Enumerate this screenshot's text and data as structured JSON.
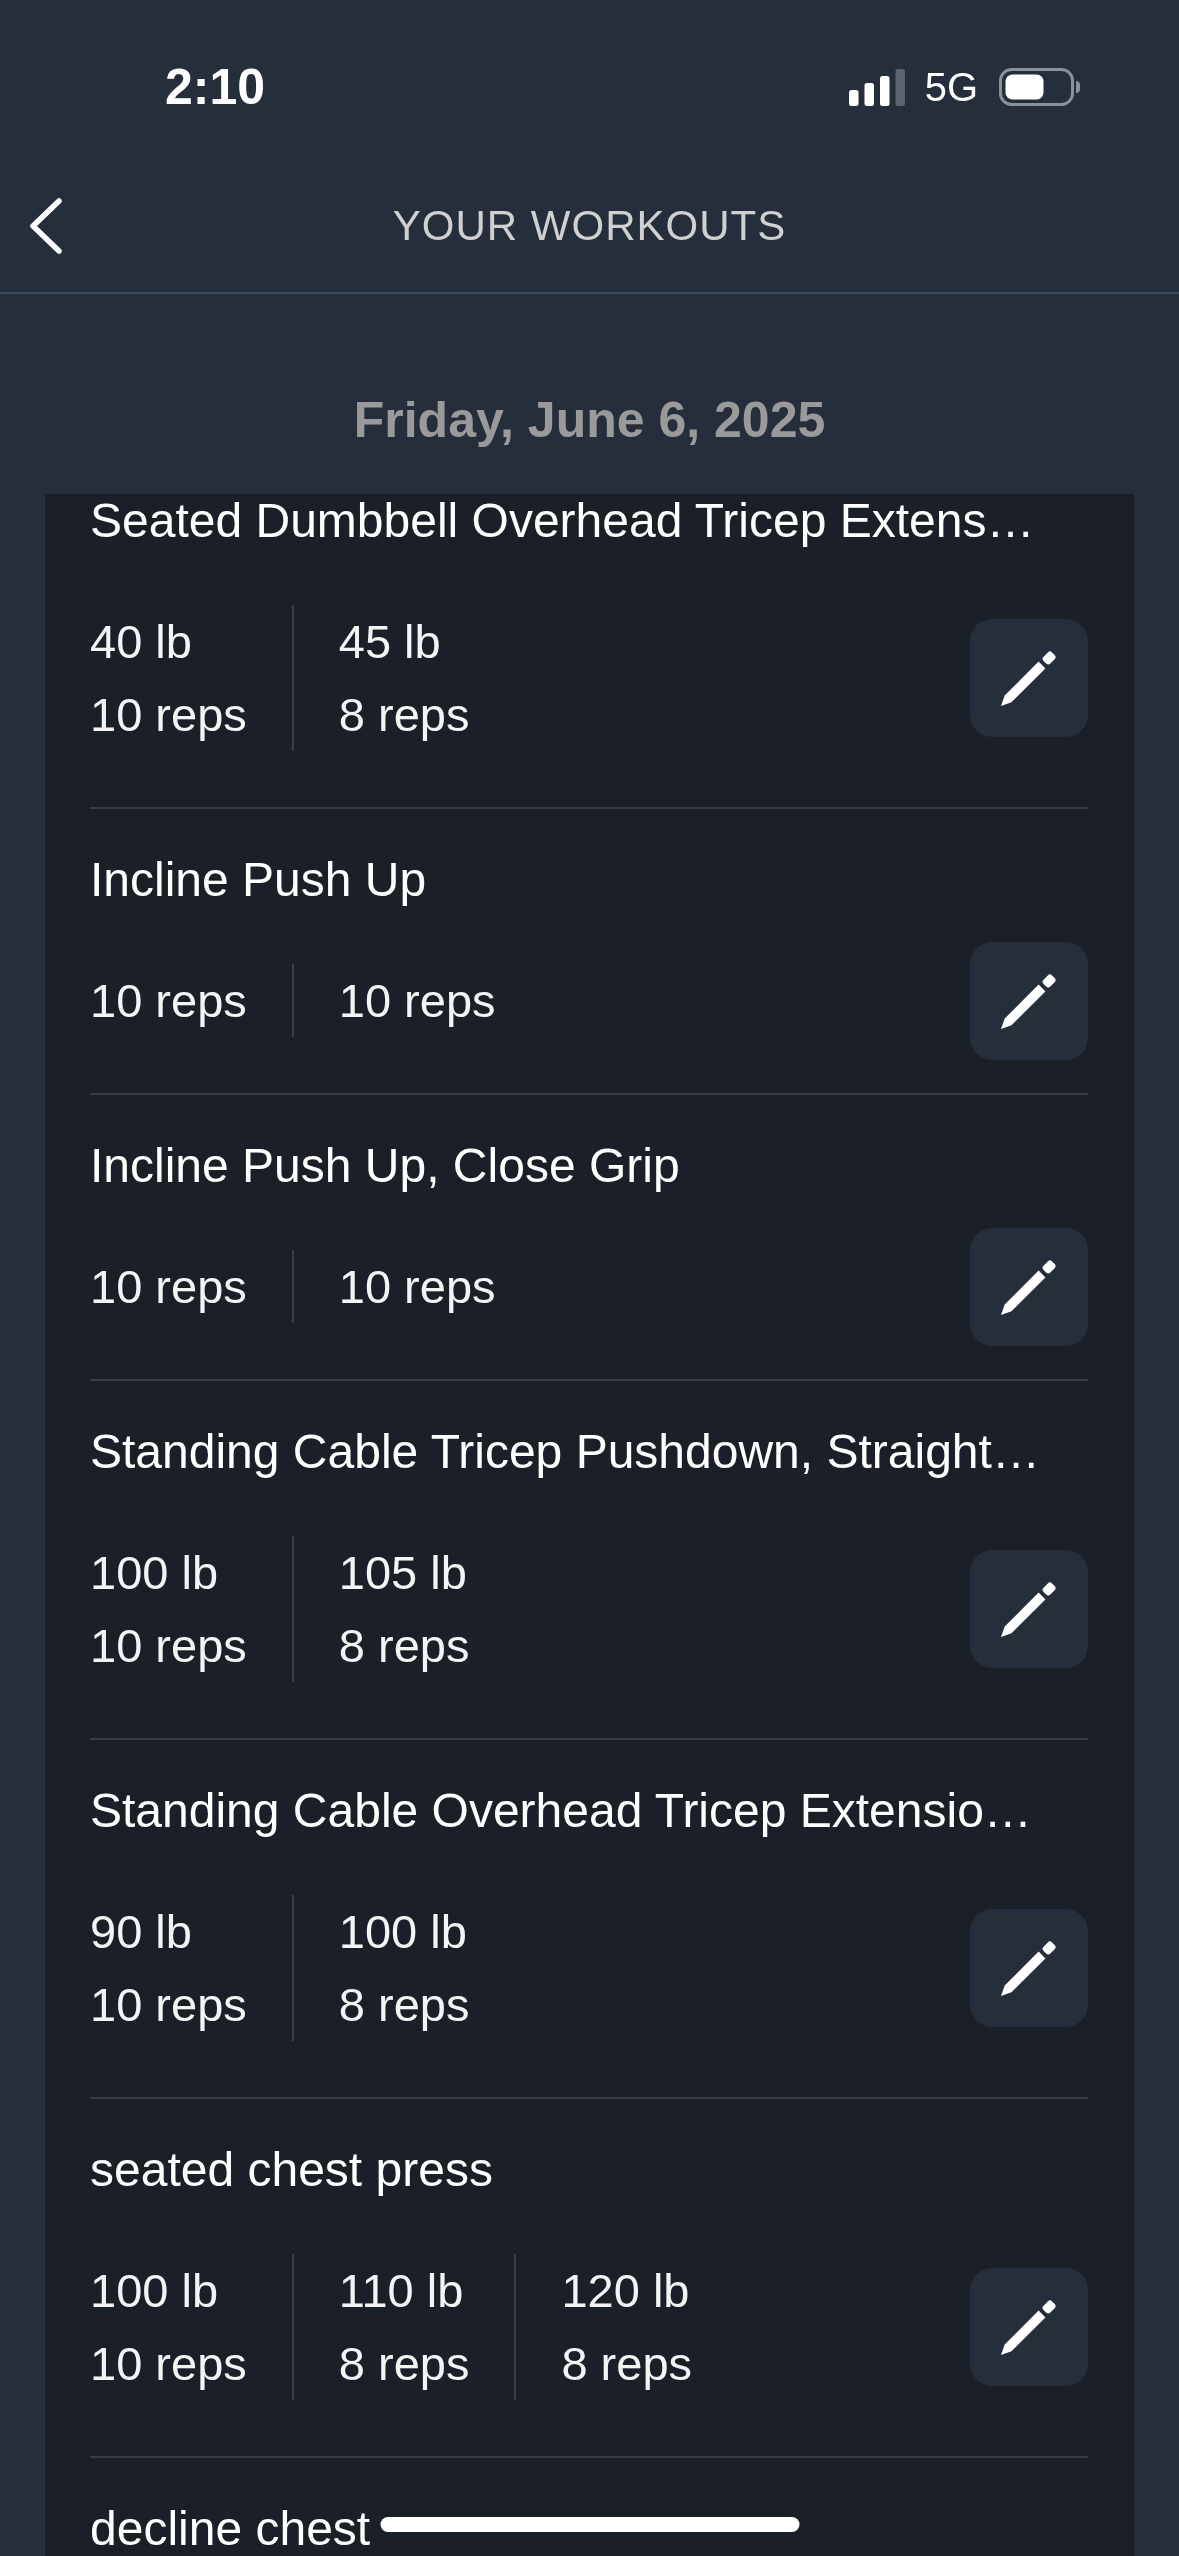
{
  "status_bar": {
    "time": "2:10",
    "network": "5G"
  },
  "header": {
    "title": "YOUR WORKOUTS"
  },
  "date": "Friday, June 6, 2025",
  "exercises": [
    {
      "name": "Seated Dumbbell Overhead Tricep Extens…",
      "sets": [
        {
          "weight": "40 lb",
          "reps": "10 reps"
        },
        {
          "weight": "45 lb",
          "reps": "8 reps"
        }
      ]
    },
    {
      "name": "Incline Push Up",
      "sets": [
        {
          "reps": "10 reps"
        },
        {
          "reps": "10 reps"
        }
      ]
    },
    {
      "name": "Incline Push Up, Close Grip",
      "sets": [
        {
          "reps": "10 reps"
        },
        {
          "reps": "10 reps"
        }
      ]
    },
    {
      "name": "Standing Cable Tricep Pushdown, Straight…",
      "sets": [
        {
          "weight": "100 lb",
          "reps": "10 reps"
        },
        {
          "weight": "105 lb",
          "reps": "8 reps"
        }
      ]
    },
    {
      "name": "Standing Cable Overhead Tricep Extensio…",
      "sets": [
        {
          "weight": "90 lb",
          "reps": "10 reps"
        },
        {
          "weight": "100 lb",
          "reps": "8 reps"
        }
      ]
    },
    {
      "name": "seated chest press",
      "sets": [
        {
          "weight": "100 lb",
          "reps": "10 reps"
        },
        {
          "weight": "110 lb",
          "reps": "8 reps"
        },
        {
          "weight": "120 lb",
          "reps": "8 reps"
        }
      ]
    },
    {
      "name": "decline chest"
    }
  ]
}
